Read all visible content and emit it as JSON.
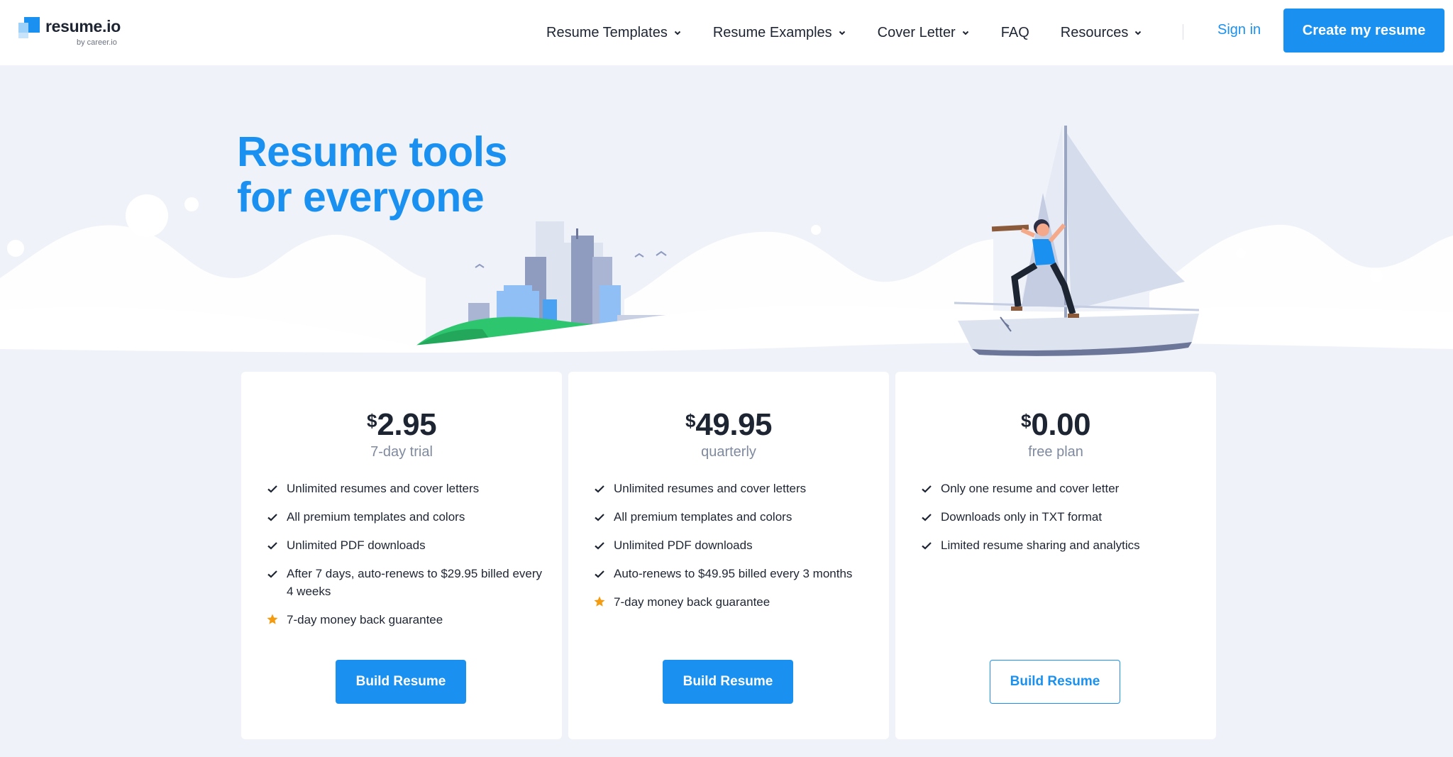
{
  "header": {
    "logo": {
      "name": "resume.io",
      "sub": "by career.io"
    },
    "nav": [
      {
        "label": "Resume Templates",
        "dropdown": true
      },
      {
        "label": "Resume Examples",
        "dropdown": true
      },
      {
        "label": "Cover Letter",
        "dropdown": true
      },
      {
        "label": "FAQ",
        "dropdown": false
      },
      {
        "label": "Resources",
        "dropdown": true
      }
    ],
    "sign_in": "Sign in",
    "cta": "Create my resume"
  },
  "hero": {
    "title_line1": "Resume tools",
    "title_line2": "for everyone"
  },
  "plans": [
    {
      "currency": "$",
      "amount": "2.95",
      "period": "7-day trial",
      "features": [
        {
          "text": "Unlimited resumes and cover letters",
          "icon": "check-icon"
        },
        {
          "text": "All premium templates and colors",
          "icon": "check-icon"
        },
        {
          "text": "Unlimited PDF downloads",
          "icon": "check-icon"
        },
        {
          "text": "After 7 days, auto-renews to $29.95 billed every 4 weeks",
          "icon": "check-icon"
        },
        {
          "text": "7-day money back guarantee",
          "icon": "star-icon"
        }
      ],
      "button": "Build Resume",
      "button_style": "primary"
    },
    {
      "currency": "$",
      "amount": "49.95",
      "period": "quarterly",
      "features": [
        {
          "text": "Unlimited resumes and cover letters",
          "icon": "check-icon"
        },
        {
          "text": "All premium templates and colors",
          "icon": "check-icon"
        },
        {
          "text": "Unlimited PDF downloads",
          "icon": "check-icon"
        },
        {
          "text": "Auto-renews to $49.95 billed every 3 months",
          "icon": "check-icon"
        },
        {
          "text": "7-day money back guarantee",
          "icon": "star-icon"
        }
      ],
      "button": "Build Resume",
      "button_style": "primary"
    },
    {
      "currency": "$",
      "amount": "0.00",
      "period": "free plan",
      "features": [
        {
          "text": "Only one resume and cover letter",
          "icon": "check-icon"
        },
        {
          "text": "Downloads only in TXT format",
          "icon": "check-icon"
        },
        {
          "text": "Limited resume sharing and analytics",
          "icon": "check-icon"
        }
      ],
      "button": "Build Resume",
      "button_style": "outline"
    }
  ],
  "colors": {
    "accent": "#1a91f0",
    "page_bg": "#eff2f9",
    "text": "#1e2532",
    "muted": "#7f8a9e",
    "star": "#f39c12"
  }
}
